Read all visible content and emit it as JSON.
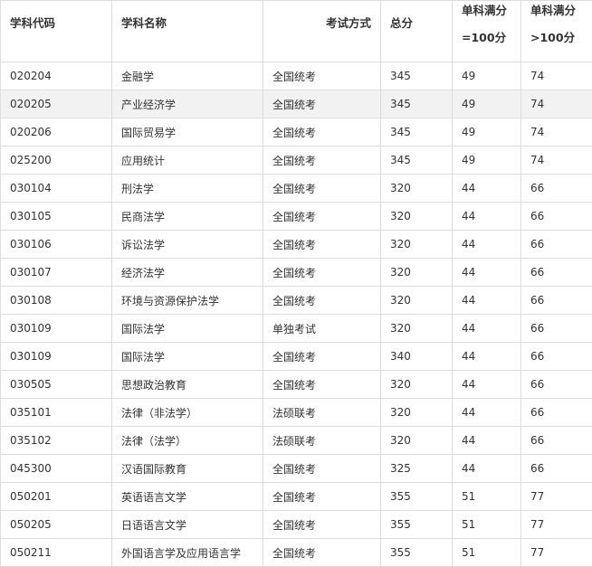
{
  "header": {
    "code": "学科代码",
    "name": "学科名称",
    "method": "考试方式",
    "total": "总分",
    "full1_line1": "单科满分",
    "full1_line2": "=100分",
    "full2_line1": "单科满分",
    "full2_line2": ">100分"
  },
  "rows": [
    {
      "code": "020204",
      "name": "金融学",
      "method": "全国统考",
      "total": "345",
      "s100": "49",
      "s150": "74"
    },
    {
      "code": "020205",
      "name": "产业经济学",
      "method": "全国统考",
      "total": "345",
      "s100": "49",
      "s150": "74"
    },
    {
      "code": "020206",
      "name": "国际贸易学",
      "method": "全国统考",
      "total": "345",
      "s100": "49",
      "s150": "74"
    },
    {
      "code": "025200",
      "name": "应用统计",
      "method": "全国统考",
      "total": "345",
      "s100": "49",
      "s150": "74"
    },
    {
      "code": "030104",
      "name": "刑法学",
      "method": "全国统考",
      "total": "320",
      "s100": "44",
      "s150": "66"
    },
    {
      "code": "030105",
      "name": "民商法学",
      "method": "全国统考",
      "total": "320",
      "s100": "44",
      "s150": "66"
    },
    {
      "code": "030106",
      "name": "诉讼法学",
      "method": "全国统考",
      "total": "320",
      "s100": "44",
      "s150": "66"
    },
    {
      "code": "030107",
      "name": "经济法学",
      "method": "全国统考",
      "total": "320",
      "s100": "44",
      "s150": "66"
    },
    {
      "code": "030108",
      "name": "环境与资源保护法学",
      "method": "全国统考",
      "total": "320",
      "s100": "44",
      "s150": "66"
    },
    {
      "code": "030109",
      "name": "国际法学",
      "method": "单独考试",
      "total": "320",
      "s100": "44",
      "s150": "66"
    },
    {
      "code": "030109",
      "name": "国际法学",
      "method": "全国统考",
      "total": "340",
      "s100": "44",
      "s150": "66"
    },
    {
      "code": "030505",
      "name": "思想政治教育",
      "method": "全国统考",
      "total": "320",
      "s100": "44",
      "s150": "66"
    },
    {
      "code": "035101",
      "name": "法律（非法学）",
      "method": "法硕联考",
      "total": "320",
      "s100": "44",
      "s150": "66"
    },
    {
      "code": "035102",
      "name": "法律（法学）",
      "method": "法硕联考",
      "total": "320",
      "s100": "44",
      "s150": "66"
    },
    {
      "code": "045300",
      "name": "汉语国际教育",
      "method": "全国统考",
      "total": "325",
      "s100": "44",
      "s150": "66"
    },
    {
      "code": "050201",
      "name": "英语语言文学",
      "method": "全国统考",
      "total": "355",
      "s100": "51",
      "s150": "77"
    },
    {
      "code": "050205",
      "name": "日语语言文学",
      "method": "全国统考",
      "total": "355",
      "s100": "51",
      "s150": "77"
    },
    {
      "code": "050211",
      "name": "外国语言学及应用语言学",
      "method": "全国统考",
      "total": "355",
      "s100": "51",
      "s150": "77"
    }
  ]
}
